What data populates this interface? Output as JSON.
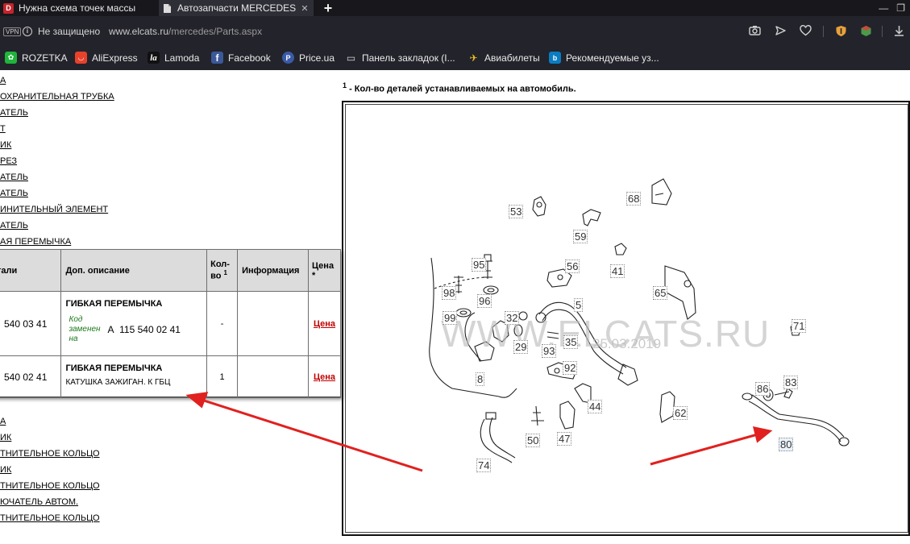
{
  "browser": {
    "tabs": [
      {
        "title": "Нужна схема точек массы",
        "favicon": "D"
      },
      {
        "title": "Автозапчасти MERCEDES -",
        "favicon": "page-icon"
      }
    ],
    "new_tab": "+",
    "vpn": "VPN",
    "security_text": "Не защищено",
    "url_host": "www.elcats.ru",
    "url_path": "/mercedes/Parts.aspx",
    "bookmarks": [
      {
        "label": "ROZETKA",
        "color": "#1fb53b",
        "glyph": "✿"
      },
      {
        "label": "AliExpress",
        "color": "#e8412c",
        "glyph": "◡"
      },
      {
        "label": "Lamoda",
        "color": "#111111",
        "glyph": "la"
      },
      {
        "label": "Facebook",
        "color": "#3b5998",
        "glyph": "f"
      },
      {
        "label": "Price.ua",
        "color": "#3a5aa8",
        "glyph": "P"
      },
      {
        "label": "Панель закладок (I...",
        "color": "",
        "glyph": "▭"
      },
      {
        "label": "Авиабилеты",
        "color": "",
        "glyph": "✈"
      },
      {
        "label": "Рекомендуемые уз...",
        "color": "#0a7dc2",
        "glyph": "b"
      }
    ]
  },
  "left_links_top": [
    "А",
    "ОХРАНИТЕЛЬНАЯ ТРУБКА",
    "АТЕЛЬ",
    "Т",
    "ИК",
    "РЕЗ",
    "АТЕЛЬ",
    "АТЕЛЬ",
    "ИНИТЕЛЬНЫЙ ЭЛЕМЕНТ",
    "АТЕЛЬ",
    "АЯ ПЕРЕМЫЧКА"
  ],
  "table": {
    "headers": {
      "part": "тали",
      "desc": "Доп. описание",
      "qty_line1": "Кол-",
      "qty_line2": "во",
      "qty_sup": "1",
      "info": "Информация",
      "price_line1": "Цена",
      "price_line2": "*"
    },
    "rows": [
      {
        "part": "540 03 41",
        "name": "ГИБКАЯ ПЕРЕМЫЧКА",
        "replaced_label_1": "Код",
        "replaced_label_2": "заменен",
        "replaced_label_3": "на",
        "replaced_code": "А  115 540 02 41",
        "extra": "",
        "qty": "-",
        "price": "Цена"
      },
      {
        "part": "540 02 41",
        "name": "ГИБКАЯ ПЕРЕМЫЧКА",
        "extra": "КАТУШКА ЗАЖИГАН. К ГБЦ",
        "qty": "1",
        "price": "Цена"
      }
    ]
  },
  "left_links_bottom": [
    "А",
    "ИК",
    "ТНИТЕЛЬНОЕ КОЛЬЦО",
    "ИК",
    "ТНИТЕЛЬНОЕ КОЛЬЦО",
    "ЮЧАТЕЛЬ АВТОМ.",
    "ТНИТЕЛЬНОЕ КОЛЬЦО"
  ],
  "note": {
    "sup": "1",
    "text": " - Кол-во деталей устанавливаемых на автомобиль."
  },
  "diagram": {
    "watermark": "WWW.ELCATS.RU",
    "date_watermark": "25.03.2019",
    "callouts": [
      "53",
      "68",
      "59",
      "95",
      "56",
      "41",
      "65",
      "98",
      "96",
      "5",
      "99",
      "32",
      "35",
      "29",
      "93",
      "8",
      "92",
      "71",
      "86",
      "83",
      "44",
      "62",
      "50",
      "47",
      "80",
      "74"
    ]
  },
  "colors": {
    "arrow": "#e0211f",
    "price_link": "#c00000",
    "replaced_text": "#1a7a1a"
  }
}
